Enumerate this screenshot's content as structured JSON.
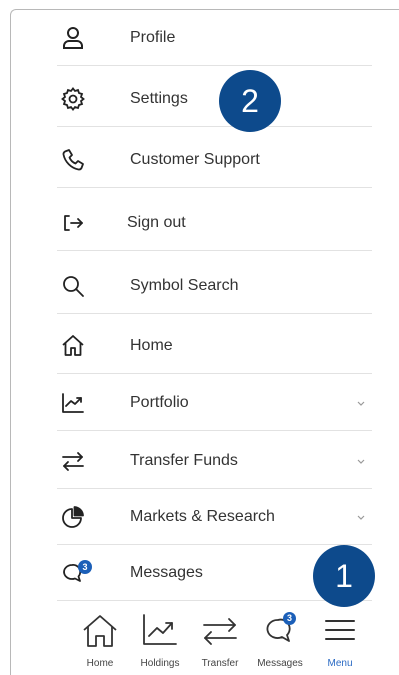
{
  "menu": {
    "items": [
      {
        "label": "Profile",
        "icon": "profile-icon"
      },
      {
        "label": "Settings",
        "icon": "gear-icon"
      },
      {
        "label": "Customer Support",
        "icon": "phone-icon"
      },
      {
        "label": "Sign out",
        "icon": "sign-out-icon"
      },
      {
        "label": "Symbol Search",
        "icon": "search-icon"
      },
      {
        "label": "Home",
        "icon": "home-icon"
      },
      {
        "label": "Portfolio",
        "icon": "chart-up-icon"
      },
      {
        "label": "Transfer Funds",
        "icon": "transfer-arrows-icon"
      },
      {
        "label": "Markets & Research",
        "icon": "pie-chart-icon"
      },
      {
        "label": "Messages",
        "icon": "messages-icon"
      }
    ],
    "messages_badge": "3"
  },
  "callouts": {
    "one": "1",
    "two": "2"
  },
  "bottom_nav": {
    "items": [
      {
        "label": "Home",
        "icon": "home-icon"
      },
      {
        "label": "Holdings",
        "icon": "chart-up-icon"
      },
      {
        "label": "Transfer",
        "icon": "transfer-arrows-icon"
      },
      {
        "label": "Messages",
        "icon": "messages-icon"
      },
      {
        "label": "Menu",
        "icon": "hamburger-icon"
      }
    ],
    "messages_badge": "3",
    "active": "Menu"
  },
  "colors": {
    "callout_bg": "#0d4a8c",
    "badge_bg": "#1b5fb8",
    "active_label": "#2a6ac4",
    "divider": "#e2e2e2"
  }
}
